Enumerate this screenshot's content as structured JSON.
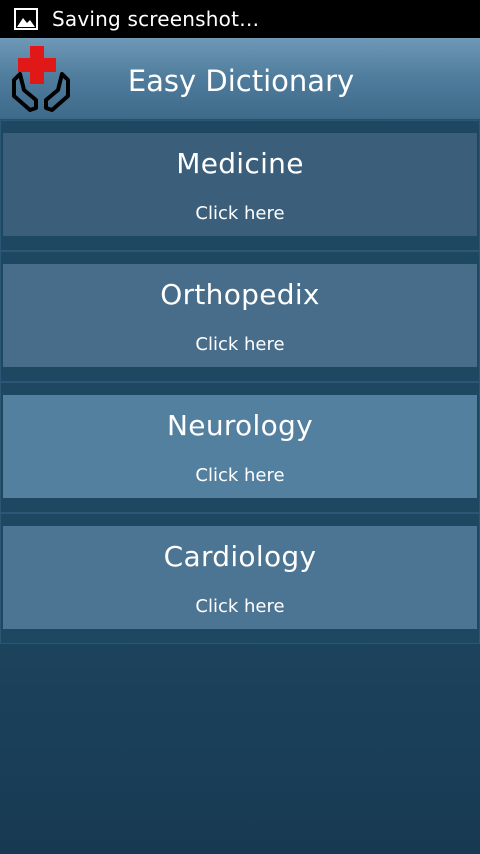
{
  "status_bar": {
    "icon": "image-icon",
    "text": "Saving screenshot…"
  },
  "app": {
    "title": "Easy Dictionary",
    "logo_icon": "medical-hands-icon"
  },
  "cards": [
    {
      "title": "Medicine",
      "subtitle": "Click here",
      "color": "#3b5f7a"
    },
    {
      "title": "Orthopedix",
      "subtitle": "Click here",
      "color": "#476d8a"
    },
    {
      "title": "Neurology",
      "subtitle": "Click here",
      "color": "#54809f"
    },
    {
      "title": "Cardiology",
      "subtitle": "Click here",
      "color": "#4c7594"
    }
  ],
  "colors": {
    "status_bar": "#000000",
    "action_bar_top": "#6e98b6",
    "background_bottom": "#173a52",
    "cross_red": "#e01818"
  }
}
